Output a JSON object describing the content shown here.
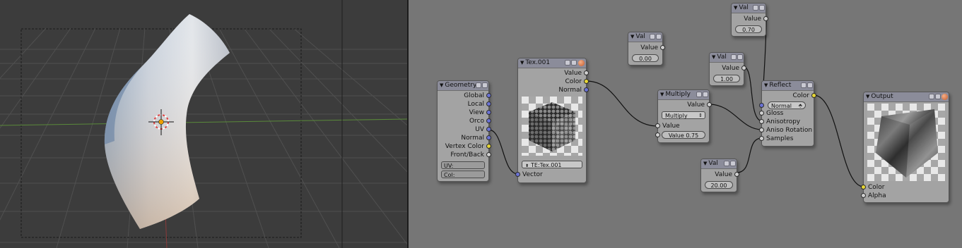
{
  "viewport": {
    "name": "3D Viewport"
  },
  "nodes": {
    "val1": {
      "title": "Val",
      "out": "Value",
      "field": "0.00"
    },
    "val2": {
      "title": "Val",
      "out": "Value",
      "field": "0.70"
    },
    "val3": {
      "title": "Val",
      "out": "Value",
      "field": "1.00"
    },
    "val4": {
      "title": "Val",
      "out": "Value",
      "field": "20.00"
    },
    "geometry": {
      "title": "Geometry",
      "outputs": [
        "Global",
        "Local",
        "View",
        "Orco",
        "UV",
        "Normal",
        "Vertex Color",
        "Front/Back"
      ],
      "fields": [
        "UV:",
        "Col:"
      ]
    },
    "tex": {
      "title": "Tex.001",
      "outputs": [
        "Value",
        "Color",
        "Normal"
      ],
      "texture_field": "TE:Tex.001",
      "input": "Vector"
    },
    "multiply": {
      "title": "Multiply",
      "out": "Value",
      "mode": "Multiply",
      "input": "Value",
      "field": "Value 0.75"
    },
    "reflect": {
      "title": "Reflect",
      "out": "Color",
      "normal_select": "Normal",
      "inputs": [
        "Gloss",
        "Anisotropy",
        "Aniso Rotation",
        "Samples"
      ]
    },
    "output": {
      "title": "Output",
      "inputs": [
        "Color",
        "Alpha"
      ]
    }
  }
}
